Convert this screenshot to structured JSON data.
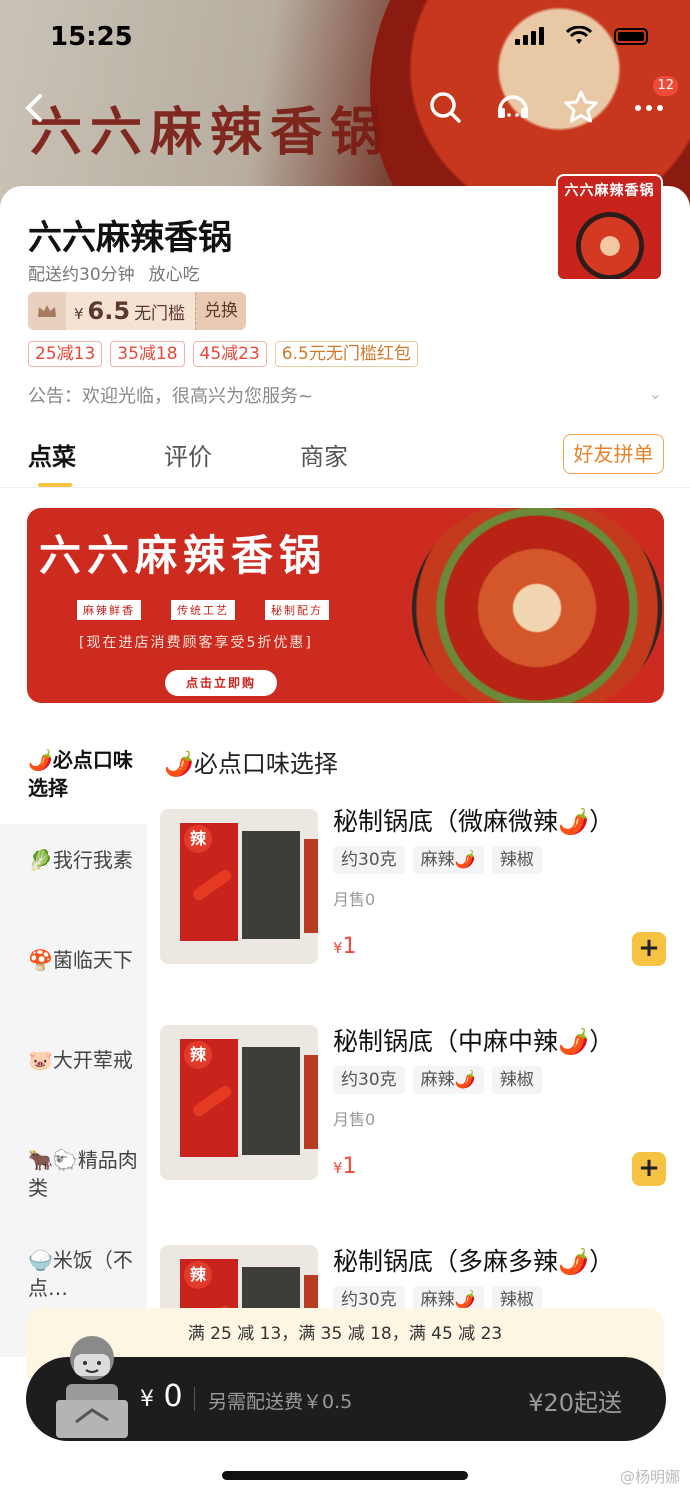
{
  "status_bar": {
    "time": "15:25"
  },
  "hero": {
    "title": "六六麻辣香锅",
    "badge_count": "12"
  },
  "logo": {
    "top_text": "六六麻辣香锅"
  },
  "shop": {
    "name": "六六麻辣香锅",
    "delivery_time": "配送约30分钟",
    "tagline": "放心吃",
    "coupon": {
      "currency": "¥",
      "amount": "6.5",
      "desc": "无门槛",
      "swap_label": "兑换"
    },
    "discount_tags": [
      "25减13",
      "35减18",
      "45减23",
      "6.5元无门槛红包"
    ],
    "notice": "公告：欢迎光临，很高兴为您服务~"
  },
  "tabs": [
    {
      "label": "点菜"
    },
    {
      "label": "评价"
    },
    {
      "label": "商家"
    }
  ],
  "group_order_label": "好友拼单",
  "banner": {
    "title": "六六麻辣香锅",
    "chips": [
      "麻辣鲜香",
      "传统工艺",
      "秘制配方"
    ],
    "line": "[现在进店消费顾客享受5折优惠]",
    "button": "点击立即购"
  },
  "sidebar": {
    "items": [
      {
        "icon": "🌶️",
        "label": "必点口味选择"
      },
      {
        "icon": "🥬",
        "label": "我行我素"
      },
      {
        "icon": "🍄",
        "label": "菌临天下"
      },
      {
        "icon": "🐷",
        "label": "大开荤戒"
      },
      {
        "icon": "🐂🐑",
        "label": "精品肉类"
      },
      {
        "icon": "🍚",
        "label": "米饭（不点…"
      }
    ]
  },
  "section": {
    "icon": "🌶️",
    "title": "必点口味选择"
  },
  "dishes": [
    {
      "name": "秘制锅底（微麻微辣🌶️）",
      "tags": [
        "约30克",
        "麻辣🌶️",
        "辣椒"
      ],
      "sales": "月售0",
      "currency": "¥",
      "price": "1",
      "img_seal": "辣"
    },
    {
      "name": "秘制锅底（中麻中辣🌶️）",
      "tags": [
        "约30克",
        "麻辣🌶️",
        "辣椒"
      ],
      "sales": "月售0",
      "currency": "¥",
      "price": "1",
      "img_seal": "辣"
    },
    {
      "name": "秘制锅底（多麻多辣🌶️）",
      "tags": [
        "约30克",
        "麻辣🌶️",
        "辣椒"
      ],
      "img_seal": "辣"
    }
  ],
  "promo_strip": "满 25 减 13，满 35 减 18，满 45 减 23",
  "cart": {
    "currency": "¥",
    "amount": "0",
    "delivery_fee_text": "另需配送费￥0.5",
    "min_order_text": "¥20起送"
  },
  "watermark": "@杨明娜",
  "colors": {
    "accent": "#f6c243",
    "price": "#f04a3a",
    "brand_red": "#c8231c"
  }
}
